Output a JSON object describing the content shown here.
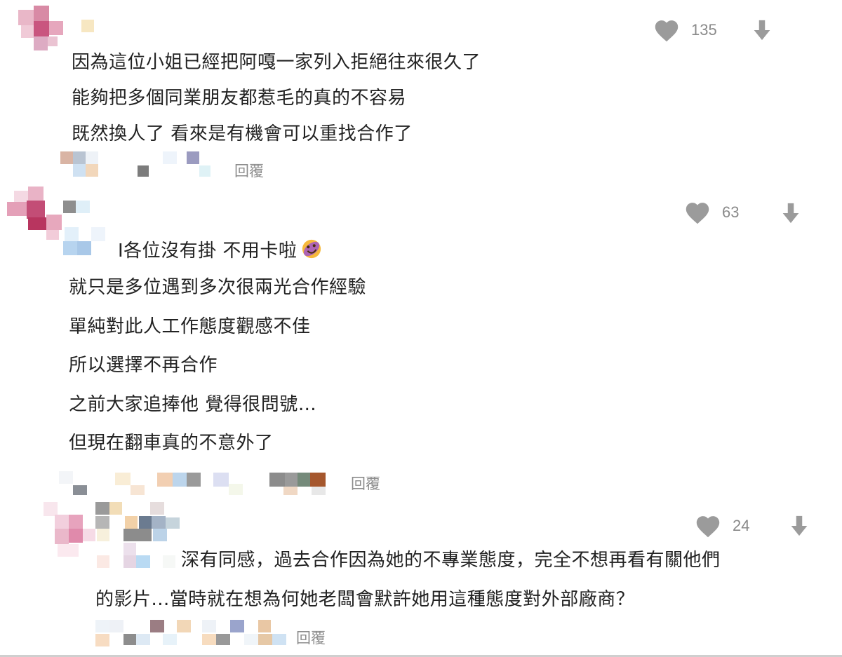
{
  "comments": [
    {
      "likes": "135",
      "lines": [
        "因為這位小姐已經把阿嘎一家列入拒絕往來很久了",
        "能夠把多個同業朋友都惹毛的真的不容易",
        "既然換人了 看來是有機會可以重找合作了"
      ],
      "reply_label": "回覆"
    },
    {
      "likes": "63",
      "lines": [
        "I各位沒有掛 不用卡啦",
        "就只是多位遇到多次很兩光合作經驗",
        "單純對此人工作態度觀感不佳",
        "所以選擇不再合作",
        "之前大家追捧他 覺得很問號…",
        "但現在翻車真的不意外了"
      ],
      "reply_label": "回覆"
    },
    {
      "likes": "24",
      "lines": [
        "深有同感，過去合作因為她的不專業態度，完全不想再看有關他們",
        "的影片...當時就在想為何她老闆會默許她用這種態度對外部廠商？"
      ],
      "reply_label": "回覆"
    }
  ],
  "icons": {
    "like": "heart-icon",
    "dislike": "down-arrow-icon",
    "emoji": "rolling-laughing-emoji"
  },
  "colors": {
    "icon_gray": "#9b9b9b",
    "text": "#222222",
    "muted": "#8a8a8a"
  }
}
